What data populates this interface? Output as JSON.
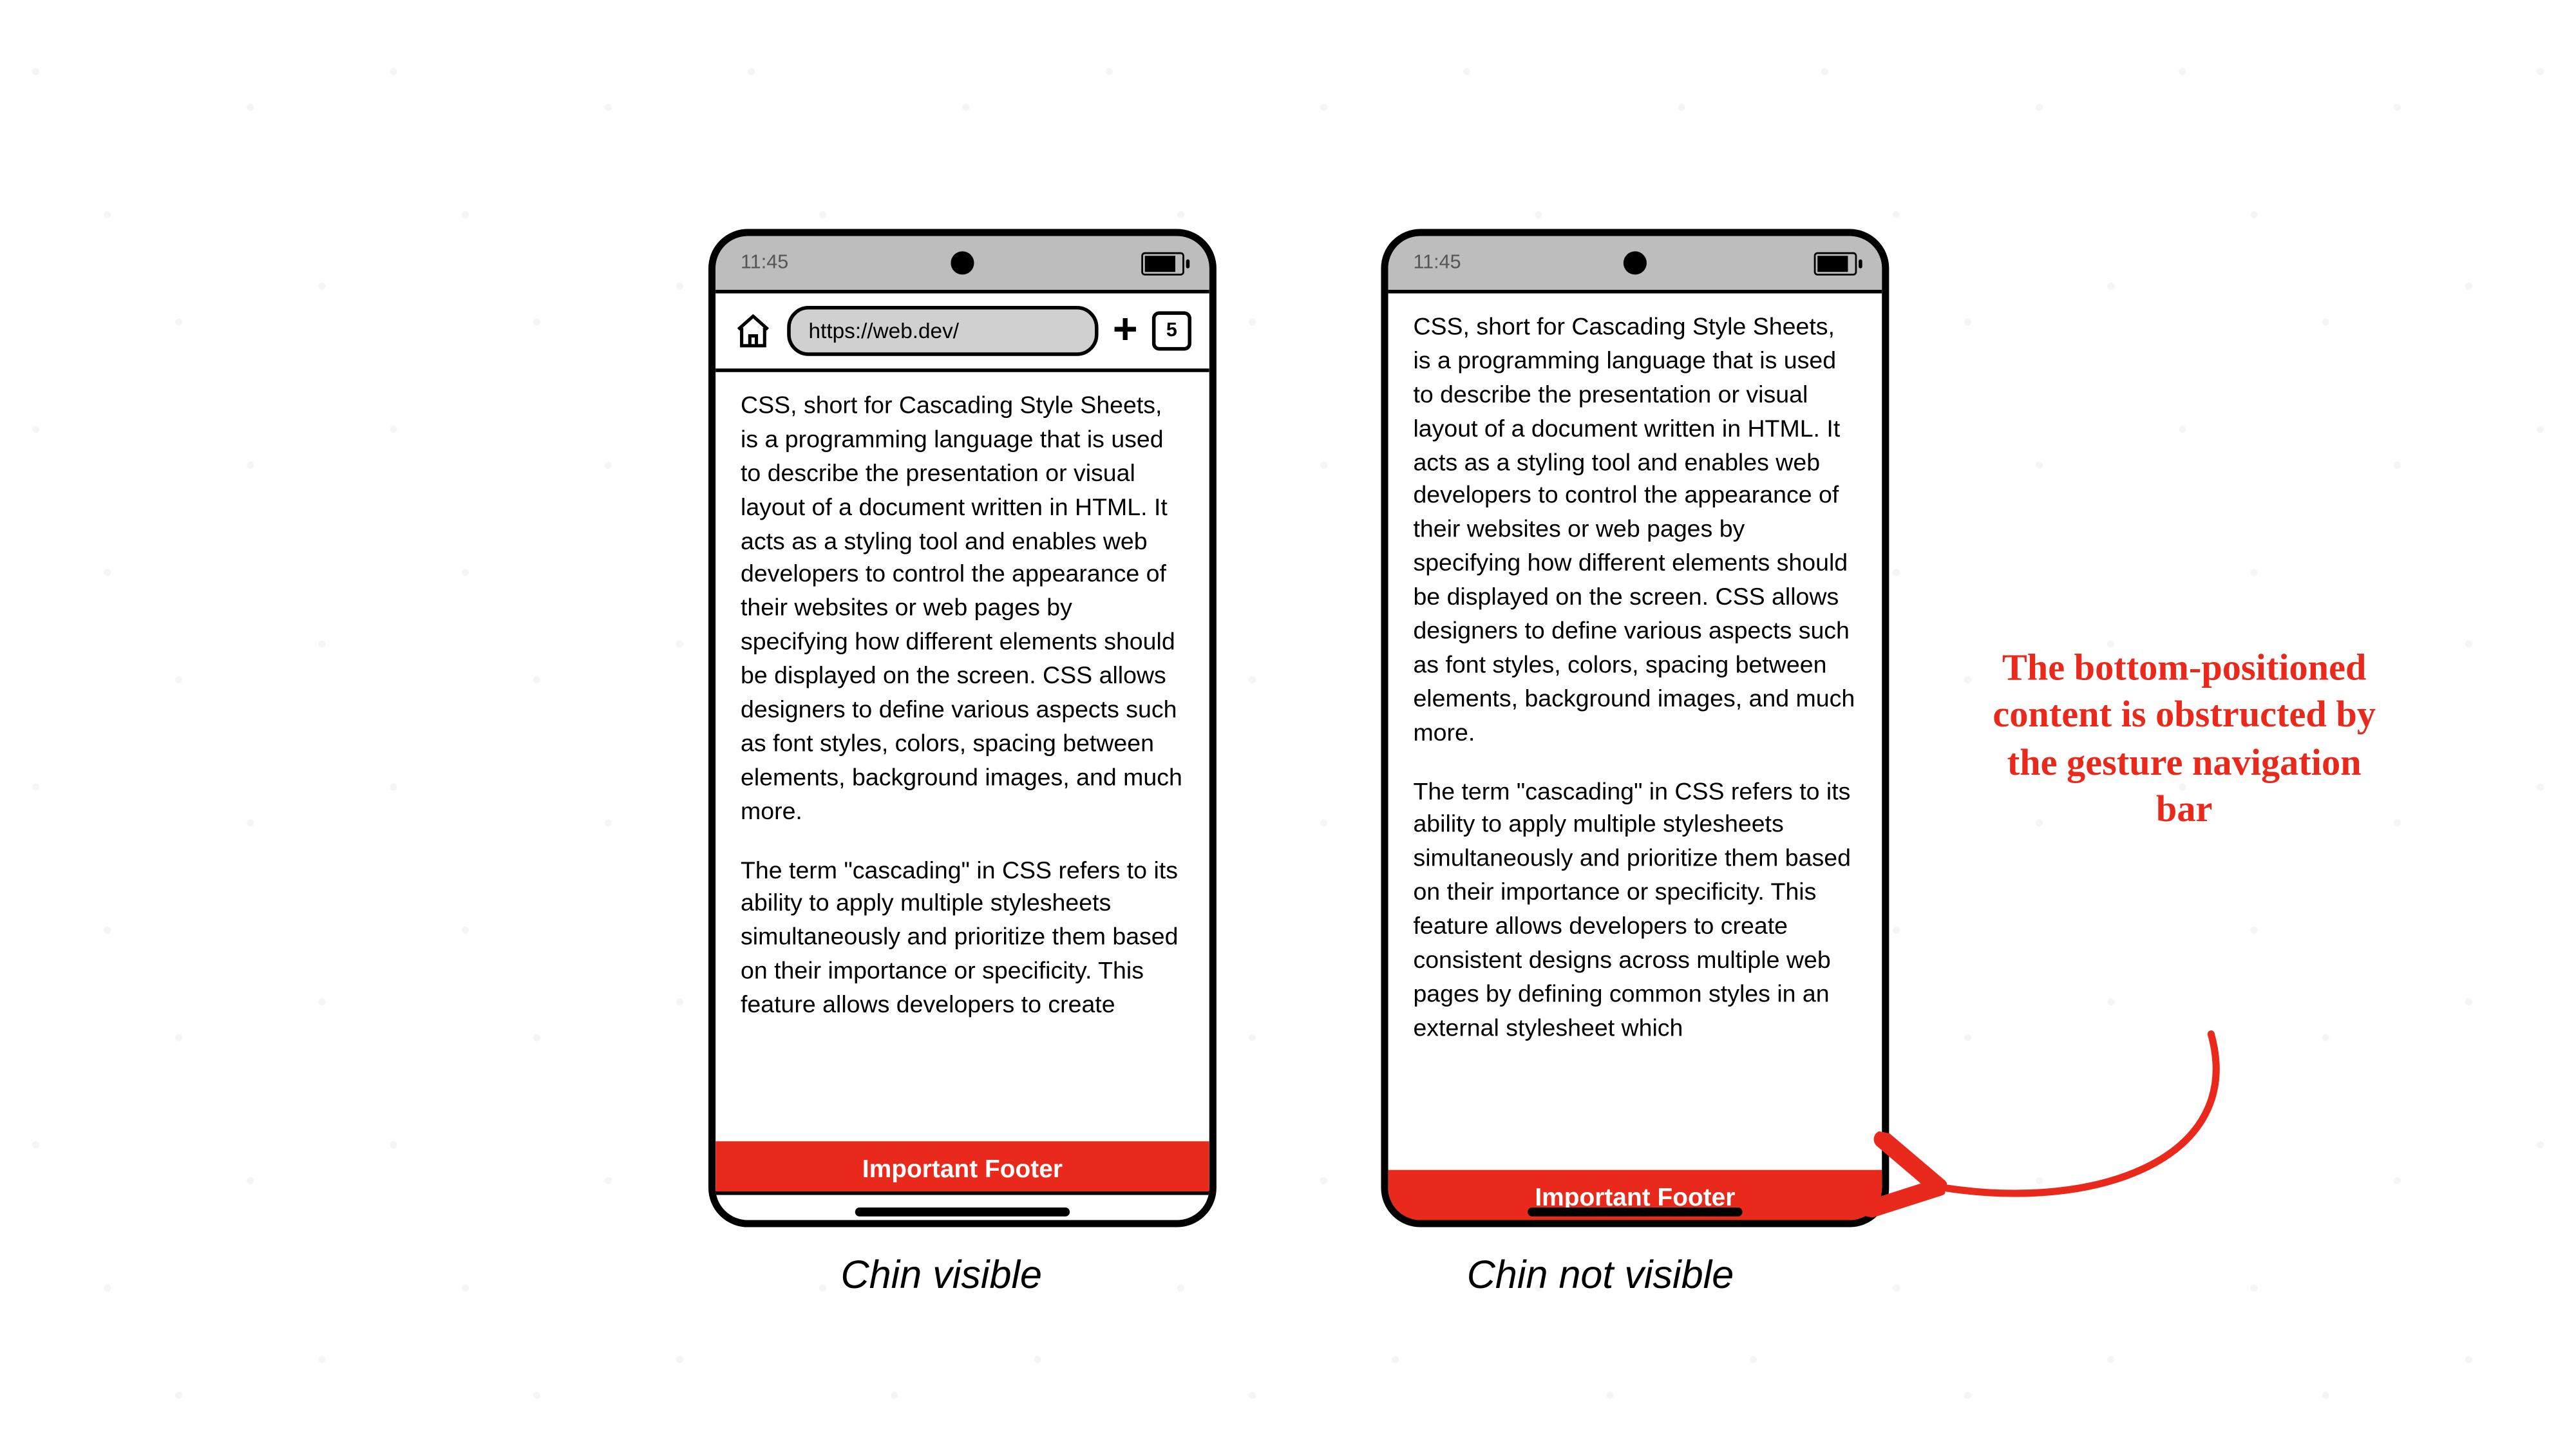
{
  "status": {
    "time": "11:45"
  },
  "addressbar": {
    "url": "https://web.dev/",
    "tab_count": "5"
  },
  "icons": {
    "home": "home-icon",
    "plus": "plus-icon",
    "tabs": "tabs-icon",
    "battery": "battery-icon",
    "camera": "camera-icon",
    "gesture_handle": "gesture-handle"
  },
  "body": {
    "para1": "CSS, short for Cascading Style Sheets, is a programming language that is used to describe the presentation or visual layout of a document written in HTML. It acts as a styling tool and enables web developers to control the appearance of their websites or web pages by specifying how different elements should be displayed on the screen. CSS allows designers to define various aspects such as font styles, colors, spacing between elements, background images, and much more.",
    "para2_short": "The term \"cascading\" in CSS refers to its ability to apply multiple stylesheets simultaneously and prioritize them based on their importance or specificity. This feature allows developers to create",
    "para2_long": "The term \"cascading\" in CSS refers to its ability to apply multiple stylesheets simultaneously and prioritize them based on their importance or specificity. This feature allows developers to create consistent designs across multiple web pages by defining common styles in an external stylesheet which"
  },
  "footer": {
    "label": "Important Footer"
  },
  "captions": {
    "left": "Chin visible",
    "right": "Chin not visible"
  },
  "callout": {
    "text": "The bottom-positioned content is obstructed by the gesture navigation bar"
  },
  "colors": {
    "footer_bg": "#e8291c",
    "callout": "#e8291c"
  }
}
